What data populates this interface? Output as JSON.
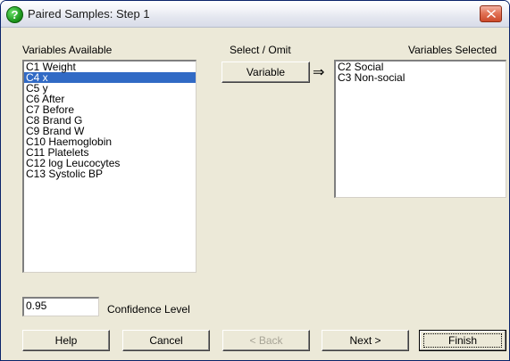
{
  "window": {
    "title": "Paired Samples: Step 1"
  },
  "labels": {
    "variables_available": "Variables Available",
    "select_omit": "Select / Omit",
    "variables_selected": "Variables Selected",
    "confidence_level": "Confidence Level"
  },
  "available_list": [
    {
      "label": "C1 Weight",
      "selected": false
    },
    {
      "label": "C4 x",
      "selected": true
    },
    {
      "label": "C5 y",
      "selected": false
    },
    {
      "label": "C6 After",
      "selected": false
    },
    {
      "label": "C7 Before",
      "selected": false
    },
    {
      "label": "C8 Brand G",
      "selected": false
    },
    {
      "label": "C9 Brand W",
      "selected": false
    },
    {
      "label": "C10 Haemoglobin",
      "selected": false
    },
    {
      "label": "C11 Platelets",
      "selected": false
    },
    {
      "label": "C12 log Leucocytes",
      "selected": false
    },
    {
      "label": "C13 Systolic BP",
      "selected": false
    }
  ],
  "selected_list": [
    {
      "label": "C2 Social"
    },
    {
      "label": "C3 Non-social"
    }
  ],
  "variable_button": "Variable",
  "arrow": "⇒",
  "confidence_value": "0.95",
  "buttons": {
    "help": "Help",
    "cancel": "Cancel",
    "back": "< Back",
    "next": "Next >",
    "finish": "Finish"
  },
  "icons": {
    "app": "help-question-icon",
    "close": "close-icon"
  }
}
